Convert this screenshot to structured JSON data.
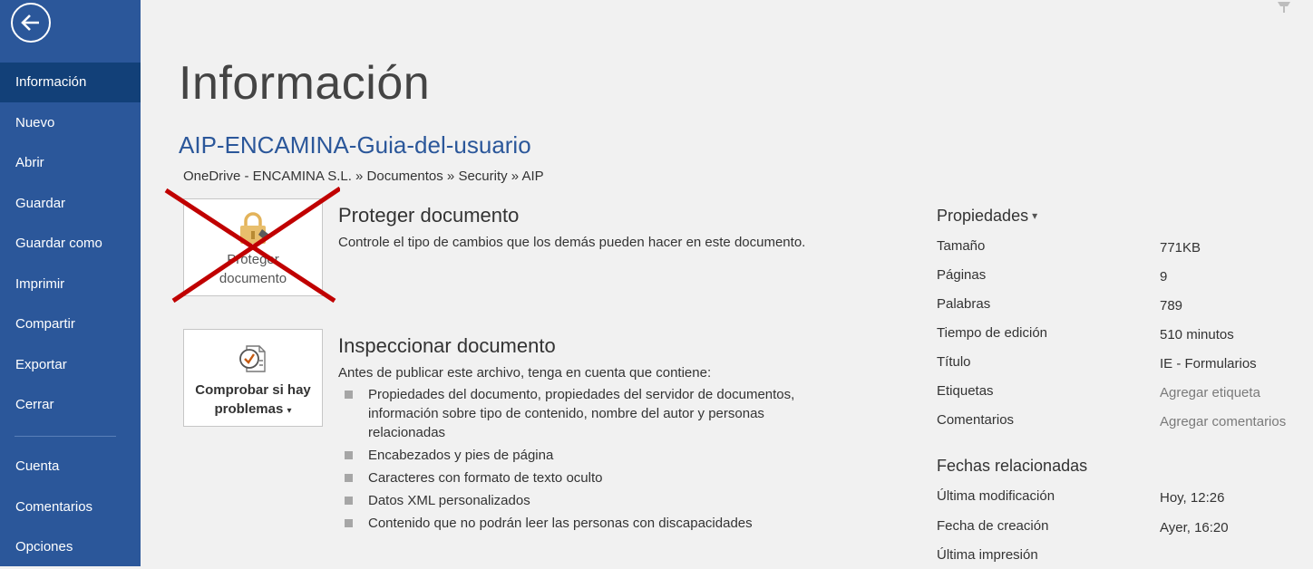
{
  "sidebar": {
    "back_icon": "back-arrow-icon",
    "items": [
      {
        "label": "Información",
        "active": true
      },
      {
        "label": "Nuevo"
      },
      {
        "label": "Abrir"
      },
      {
        "label": "Guardar"
      },
      {
        "label": "Guardar como"
      },
      {
        "label": "Imprimir"
      },
      {
        "label": "Compartir"
      },
      {
        "label": "Exportar"
      },
      {
        "label": "Cerrar"
      },
      {
        "label": "Cuenta"
      },
      {
        "label": "Comentarios"
      },
      {
        "label": "Opciones"
      }
    ]
  },
  "main": {
    "title": "Información",
    "doc_name": "AIP-ENCAMINA-Guia-del-usuario",
    "doc_path": "OneDrive - ENCAMINA S.L. » Documentos » Security » AIP",
    "protect": {
      "icon": "lock-icon",
      "box_line1": "Proteger",
      "box_line2": "documento",
      "title": "Proteger documento",
      "description": "Controle el tipo de cambios que los demás pueden hacer en este documento."
    },
    "inspect": {
      "icon": "inspect-document-icon",
      "box_line1": "Comprobar si hay",
      "box_line2": "problemas",
      "caret": "▾",
      "title": "Inspeccionar documento",
      "description": "Antes de publicar este archivo, tenga en cuenta que contiene:",
      "items": [
        "Propiedades del documento, propiedades del servidor de documentos, información sobre tipo de contenido, nombre del autor y personas relacionadas",
        "Encabezados y pies de página",
        "Caracteres con formato de texto oculto",
        "Datos XML personalizados",
        "Contenido que no podrán leer las personas con discapacidades"
      ]
    }
  },
  "properties": {
    "header": "Propiedades",
    "caret": "▾",
    "rows": [
      {
        "label": "Tamaño",
        "value": "771KB"
      },
      {
        "label": "Páginas",
        "value": "9"
      },
      {
        "label": "Palabras",
        "value": "789"
      },
      {
        "label": "Tiempo de edición",
        "value": "510 minutos"
      },
      {
        "label": "Título",
        "value": "IE - Formularios"
      },
      {
        "label": "Etiquetas",
        "value": "Agregar etiqueta"
      },
      {
        "label": "Comentarios",
        "value": "Agregar comentarios"
      }
    ],
    "dates_header": "Fechas relacionadas",
    "dates": [
      {
        "label": "Última modificación",
        "value": "Hoy, 12:26"
      },
      {
        "label": "Fecha de creación",
        "value": "Ayer, 16:20"
      },
      {
        "label": "Última impresión",
        "value": ""
      }
    ]
  },
  "colors": {
    "sidebar_bg": "#2b579a",
    "sidebar_active": "#124078",
    "accent_title": "#2b579a",
    "cross_mark": "#c00000",
    "lock_gold": "#e3b35a"
  }
}
